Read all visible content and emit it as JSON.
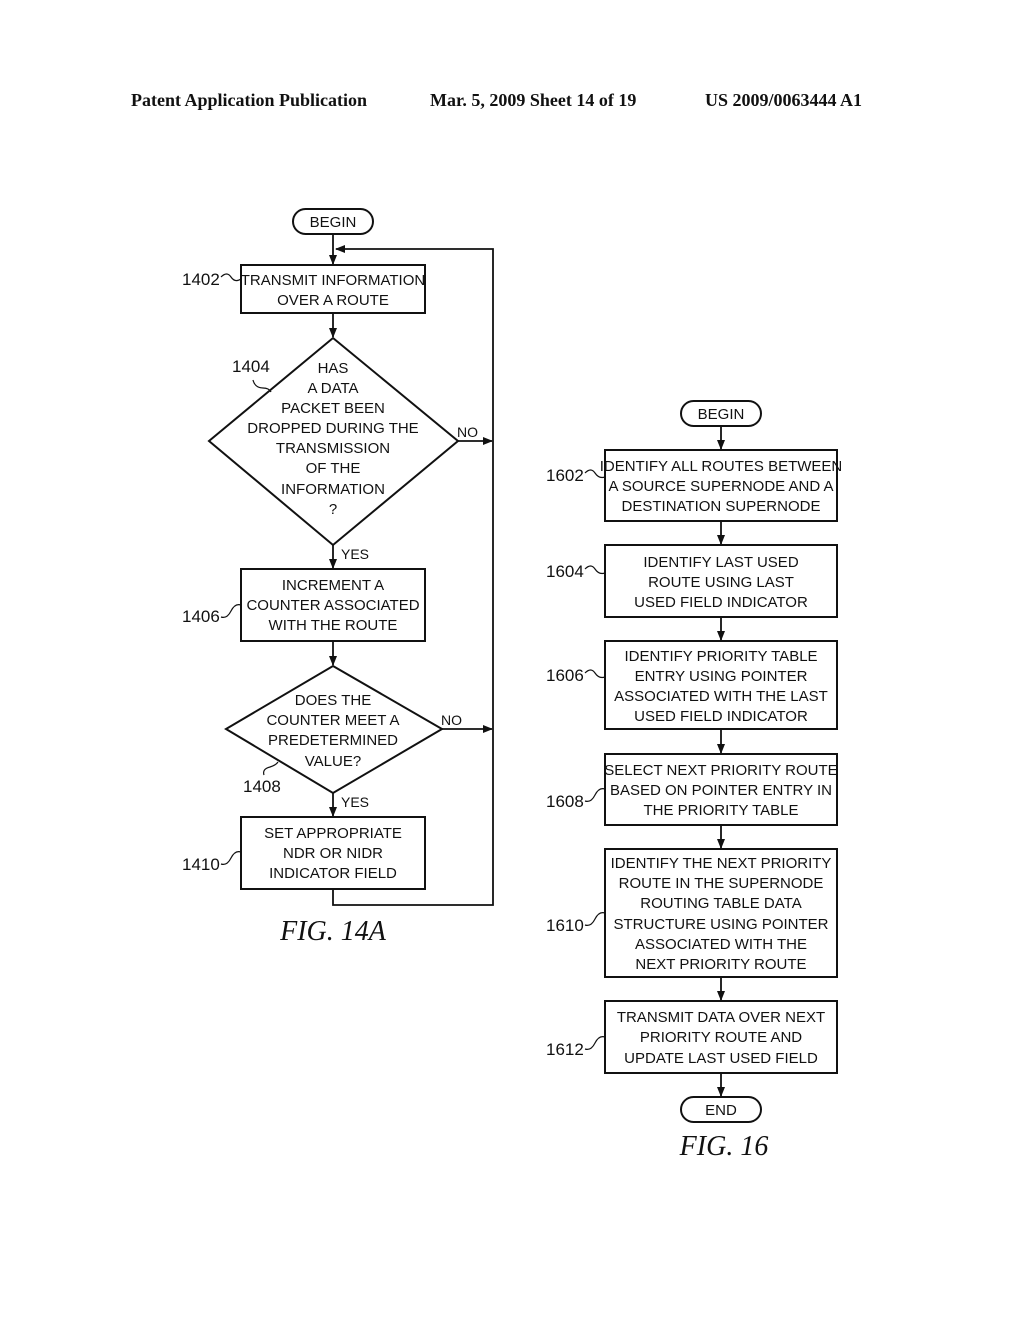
{
  "header": {
    "left": "Patent Application Publication",
    "date_sheet": "Mar. 5, 2009   Sheet 14 of 19",
    "pub_number": "US 2009/0063444 A1"
  },
  "fig14a": {
    "caption": "FIG. 14A",
    "begin": "BEGIN",
    "steps": [
      {
        "ref": "1402",
        "lines": [
          "TRANSMIT INFORMATION",
          "OVER A ROUTE"
        ]
      },
      {
        "ref": "1404",
        "lines": [
          "HAS",
          "A DATA",
          "PACKET BEEN",
          "DROPPED DURING THE",
          "TRANSMISSION",
          "OF THE",
          "INFORMATION",
          "?"
        ]
      },
      {
        "ref": "1406",
        "lines": [
          "INCREMENT A",
          "COUNTER ASSOCIATED",
          "WITH THE ROUTE"
        ]
      },
      {
        "ref": "1408",
        "lines": [
          "DOES THE",
          "COUNTER MEET A",
          "PREDETERMINED",
          "VALUE?"
        ]
      },
      {
        "ref": "1410",
        "lines": [
          "SET APPROPRIATE",
          "NDR OR NIDR",
          "INDICATOR FIELD"
        ]
      }
    ],
    "yes_label": "YES",
    "no_label": "NO"
  },
  "fig16": {
    "caption": "FIG. 16",
    "begin": "BEGIN",
    "end": "END",
    "steps": [
      {
        "ref": "1602",
        "lines": [
          "IDENTIFY ALL ROUTES BETWEEN",
          "A SOURCE SUPERNODE AND A",
          "DESTINATION SUPERNODE"
        ]
      },
      {
        "ref": "1604",
        "lines": [
          "IDENTIFY LAST USED",
          "ROUTE USING LAST",
          "USED FIELD INDICATOR"
        ]
      },
      {
        "ref": "1606",
        "lines": [
          "IDENTIFY PRIORITY TABLE",
          "ENTRY USING POINTER",
          "ASSOCIATED WITH THE LAST",
          "USED FIELD INDICATOR"
        ]
      },
      {
        "ref": "1608",
        "lines": [
          "SELECT NEXT PRIORITY ROUTE",
          "BASED ON POINTER ENTRY IN",
          "THE PRIORITY TABLE"
        ]
      },
      {
        "ref": "1610",
        "lines": [
          "IDENTIFY THE NEXT PRIORITY",
          "ROUTE IN THE SUPERNODE",
          "ROUTING TABLE DATA",
          "STRUCTURE USING POINTER",
          "ASSOCIATED WITH THE",
          "NEXT PRIORITY ROUTE"
        ]
      },
      {
        "ref": "1612",
        "lines": [
          "TRANSMIT DATA OVER NEXT",
          "PRIORITY ROUTE AND",
          "UPDATE LAST USED FIELD"
        ]
      }
    ]
  }
}
